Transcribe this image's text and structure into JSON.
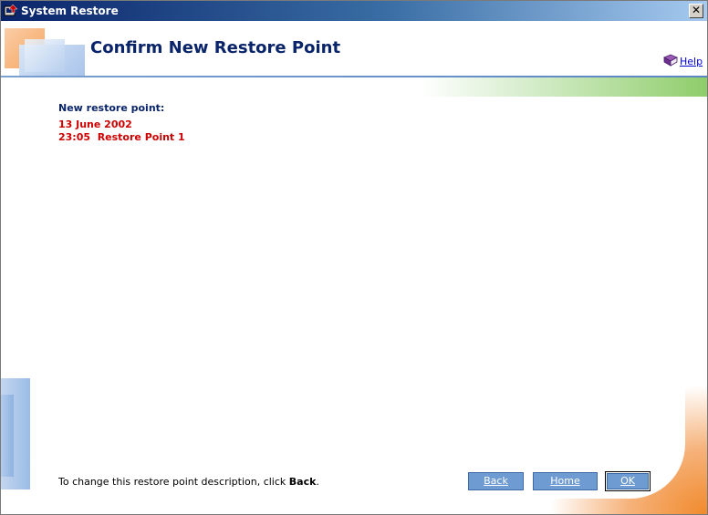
{
  "window": {
    "title": "System Restore",
    "close_glyph": "✕",
    "icon": "system-restore-icon"
  },
  "header": {
    "title": "Confirm New Restore Point",
    "help_label": "Help",
    "help_icon": "help-book-icon"
  },
  "content": {
    "label": "New restore point:",
    "date": "13 June 2002",
    "time": "23:05",
    "description": "Restore Point 1"
  },
  "footer": {
    "hint_prefix": "To change this restore point description, click ",
    "hint_bold": "Back",
    "hint_suffix": ".",
    "buttons": {
      "back": "Back",
      "home": "Home",
      "ok": "OK"
    }
  },
  "colors": {
    "title_text": "#0a246a",
    "restore_point_text": "#cc0000",
    "button_fill": "#6e9bd1",
    "accent_green": "#8fcd6a",
    "accent_orange": "#f08a2c"
  }
}
